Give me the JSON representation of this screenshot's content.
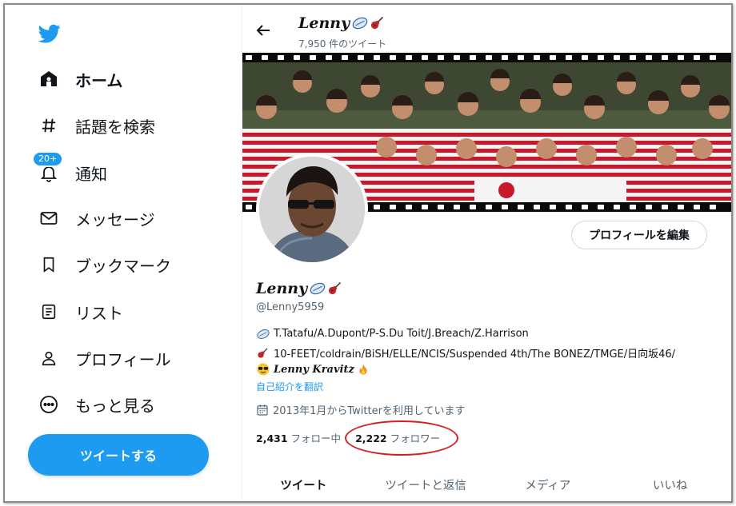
{
  "colors": {
    "accent": "#1d9bf0",
    "annotation": "#d21f26",
    "muted": "#536471"
  },
  "sidebar": {
    "logo_icon": "twitter-bird-icon",
    "items": [
      {
        "label": "ホーム",
        "icon": "home-icon",
        "active": true
      },
      {
        "label": "話題を検索",
        "icon": "hashtag-icon"
      },
      {
        "label": "通知",
        "icon": "bell-icon",
        "badge": "20+"
      },
      {
        "label": "メッセージ",
        "icon": "envelope-icon"
      },
      {
        "label": "ブックマーク",
        "icon": "bookmark-icon"
      },
      {
        "label": "リスト",
        "icon": "list-icon"
      },
      {
        "label": "プロフィール",
        "icon": "person-icon"
      },
      {
        "label": "もっと見る",
        "icon": "more-icon"
      }
    ],
    "tweet_button": "ツイートする"
  },
  "header": {
    "name": "Lenny",
    "tweet_count": "7,950 件のツイート"
  },
  "profile": {
    "edit_button": "プロフィールを編集",
    "name": "Lenny",
    "handle": "@Lenny5959",
    "bio": [
      "T.Tatafu/A.Dupont/P-S.Du Toit/J.Breach/Z.Harrison",
      "10-FEET/coldrain/BiSH/ELLE/NCIS/Suspended 4th/The BONEZ/TMGE/日向坂46/",
      "Lenny Kravitz"
    ],
    "translate_link": "自己紹介を翻訳",
    "joined": "2013年1月からTwitterを利用しています",
    "following_count": "2,431",
    "following_label": "フォロー中",
    "followers_count": "2,222",
    "followers_label": "フォロワー"
  },
  "tabs": [
    "ツイート",
    "ツイートと返信",
    "メディア",
    "いいね"
  ]
}
